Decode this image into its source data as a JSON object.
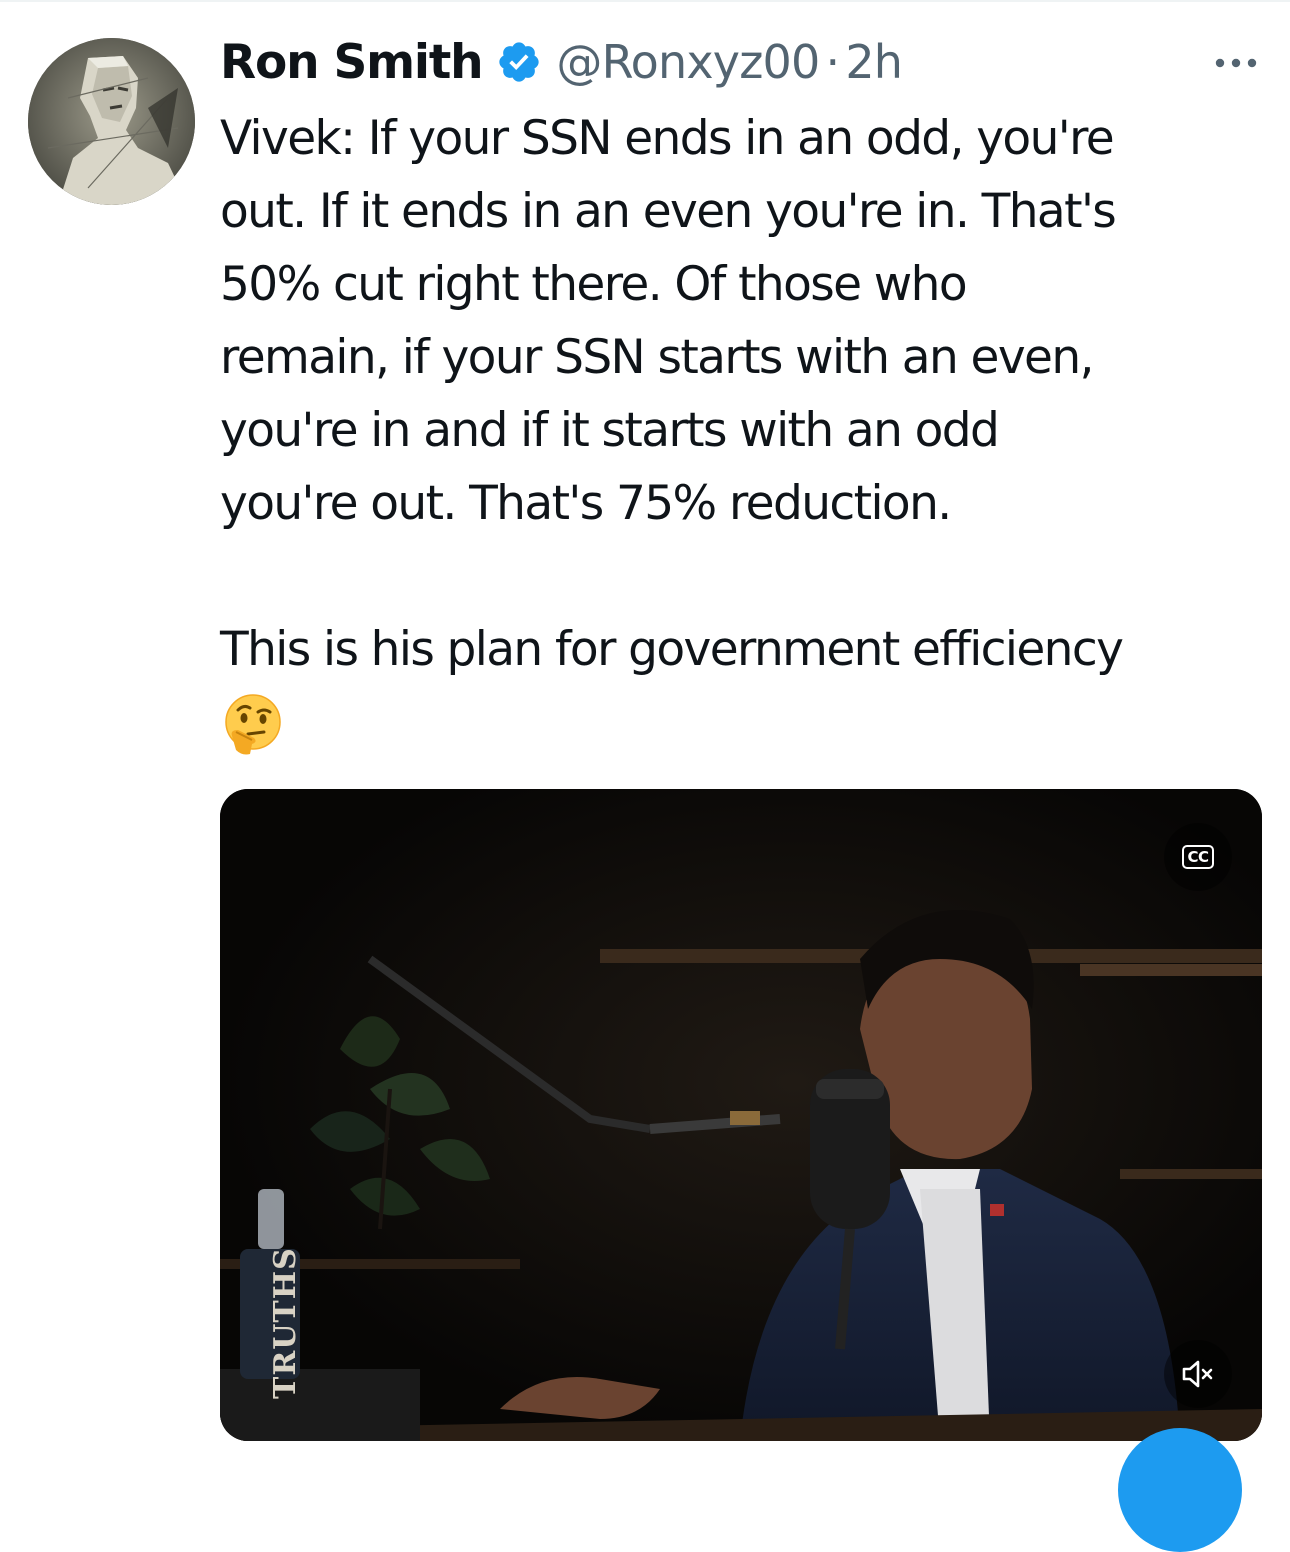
{
  "tweet": {
    "author_name": "Ron Smith",
    "handle": "@Ronxyz00",
    "separator": "·",
    "timestamp": "2h",
    "verified": true,
    "text_lines": [
      "Vivek: If your SSN ends in an odd, you're",
      "out. If it ends in an even you're in. That's",
      "50% cut right there. Of those who",
      "remain, if your SSN starts with an even,",
      "you're in and if it starts with an odd",
      "you're out. That's 75% reduction."
    ],
    "text_line_2": "This is his plan for government efficiency",
    "emoji": "🤔"
  },
  "media": {
    "cc_label": "CC",
    "book_text": "TRUTHS"
  },
  "icons": {
    "verified": "verified-badge-icon",
    "more": "more-icon",
    "cc": "closed-captions-icon",
    "mute": "volume-muted-icon",
    "emoji": "thinking-face-icon"
  },
  "colors": {
    "verified_blue": "#1d9bf0",
    "secondary_text": "#536471",
    "primary_text": "#0f1419"
  }
}
